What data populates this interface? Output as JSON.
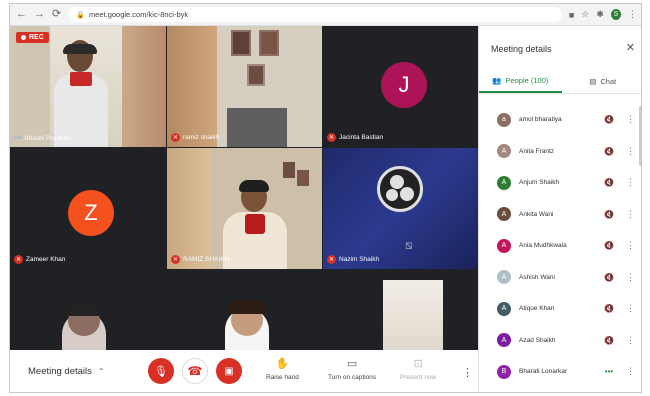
{
  "browser": {
    "url": "meet.google.com/kic-8nci-byk",
    "profile_initial": "S"
  },
  "meeting": {
    "rec_label": "REC",
    "tiles": [
      {
        "name": "Shashi Pradhan",
        "muted": false
      },
      {
        "name": "ramiz shaikh",
        "muted": true
      },
      {
        "name": "Jacinta Bastian",
        "muted": true,
        "avatar_letter": "J",
        "avatar_color": "#ad1457"
      },
      {
        "name": "Zameer Khan",
        "muted": true,
        "avatar_letter": "Z",
        "avatar_color": "#f4511e"
      },
      {
        "name": "RAMIZ SHAIKH",
        "muted": true
      },
      {
        "name": "Nazim Shaikh",
        "muted": true
      }
    ]
  },
  "toolbar": {
    "meeting_details": "Meeting details",
    "raise_hand": "Raise hand",
    "captions": "Turn on captions",
    "present": "Present now"
  },
  "panel": {
    "title": "Meeting details",
    "people_tab": "People (100)",
    "chat_tab": "Chat",
    "people": [
      {
        "name": "amol bharatiya",
        "initial": "a",
        "color": "#8d6e63"
      },
      {
        "name": "Anita Frantz",
        "initial": "A",
        "color": "#a1887f"
      },
      {
        "name": "Anjum Shaikh",
        "initial": "A",
        "color": "#2e7d32"
      },
      {
        "name": "Ankita Wani",
        "initial": "A",
        "color": "#6d4c41"
      },
      {
        "name": "Ania Mudhkwala",
        "initial": "A",
        "color": "#c2185b"
      },
      {
        "name": "Ashish Wani",
        "initial": "A",
        "color": "#b0bec5"
      },
      {
        "name": "Atique Khan",
        "initial": "A",
        "color": "#455a64"
      },
      {
        "name": "Azad Shaikh",
        "initial": "A",
        "color": "#7b1fa2"
      },
      {
        "name": "Bharati Lonarkar",
        "initial": "B",
        "color": "#8e24aa"
      }
    ]
  },
  "colors": {
    "accent": "#1e8e3e",
    "danger": "#d93025"
  }
}
